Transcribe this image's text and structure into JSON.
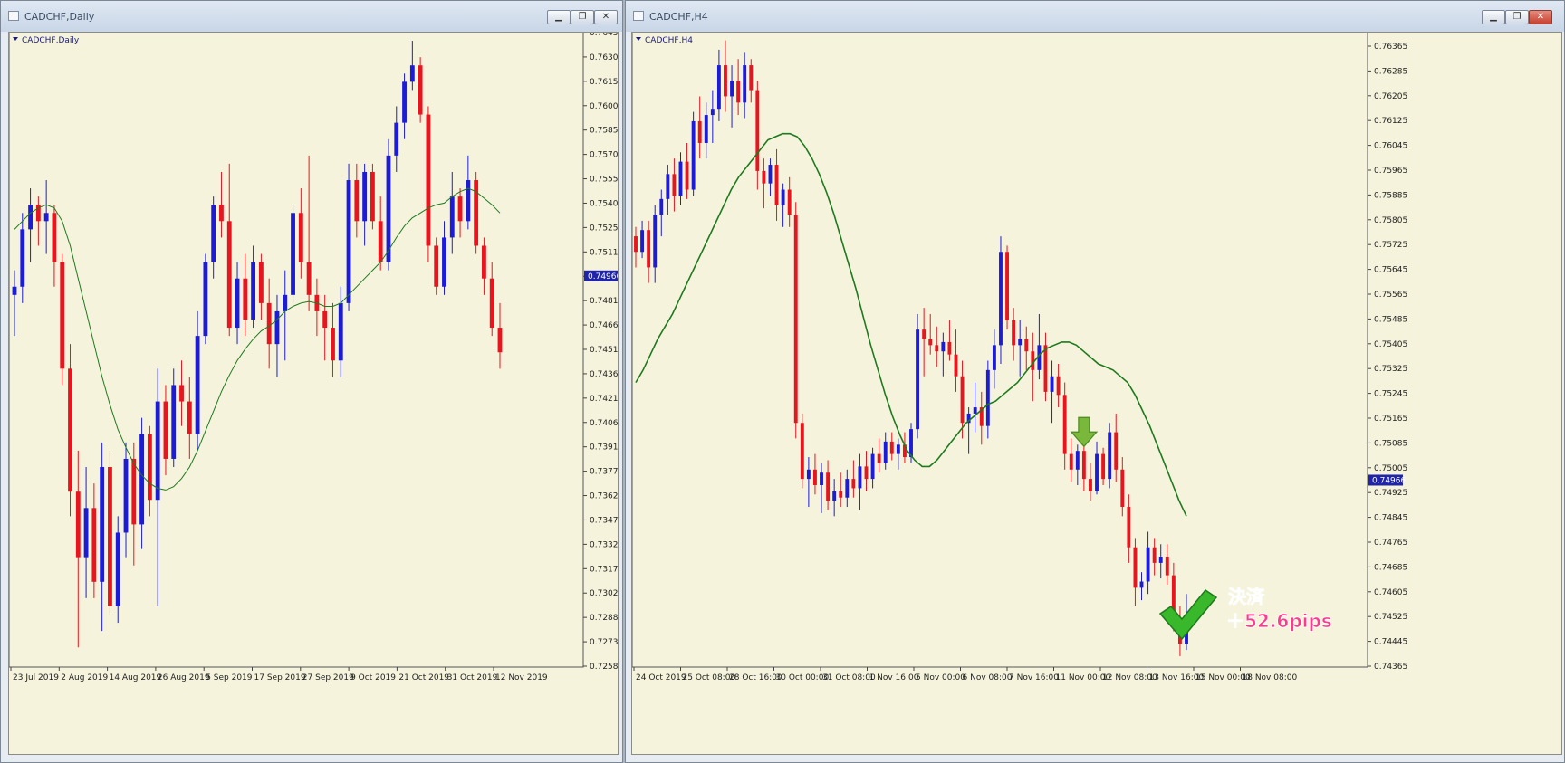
{
  "windows": [
    {
      "id": "daily",
      "title": "CADCHF,Daily",
      "chart_label": "CADCHF,Daily",
      "current_price": "0.74966",
      "price_ticks": [
        "0.76450",
        "0.76300",
        "0.76150",
        "0.76000",
        "0.75850",
        "0.75700",
        "0.75555",
        "0.75405",
        "0.75255",
        "0.75110",
        "0.74960",
        "0.74810",
        "0.74660",
        "0.74510",
        "0.74360",
        "0.74215",
        "0.74065",
        "0.73915",
        "0.73770",
        "0.73620",
        "0.73470",
        "0.73325",
        "0.73175",
        "0.73025",
        "0.72880",
        "0.72730",
        "0.72580"
      ],
      "time_ticks": [
        "23 Jul 2019",
        "2 Aug 2019",
        "14 Aug 2019",
        "26 Aug 2019",
        "5 Sep 2019",
        "17 Sep 2019",
        "27 Sep 2019",
        "9 Oct 2019",
        "21 Oct 2019",
        "31 Oct 2019",
        "12 Nov 2019"
      ]
    },
    {
      "id": "h4",
      "title": "CADCHF,H4",
      "chart_label": "CADCHF,H4",
      "current_price": "0.74966",
      "price_ticks": [
        "0.76365",
        "0.76285",
        "0.76205",
        "0.76125",
        "0.76045",
        "0.75965",
        "0.75885",
        "0.75805",
        "0.75725",
        "0.75645",
        "0.75565",
        "0.75485",
        "0.75405",
        "0.75325",
        "0.75245",
        "0.75165",
        "0.75085",
        "0.75005",
        "0.74925",
        "0.74845",
        "0.74765",
        "0.74685",
        "0.74605",
        "0.74525",
        "0.74445",
        "0.74365"
      ],
      "time_ticks": [
        "24 Oct 2019",
        "25 Oct 08:00",
        "28 Oct 16:00",
        "30 Oct 00:00",
        "31 Oct 08:00",
        "1 Nov 16:00",
        "5 Nov 00:00",
        "6 Nov 08:00",
        "7 Nov 16:00",
        "11 Nov 00:00",
        "12 Nov 08:00",
        "13 Nov 16:00",
        "15 Nov 00:00",
        "18 Nov 08:00"
      ],
      "annotation": {
        "line1": "決済",
        "line2": "＋52.6pips"
      }
    }
  ],
  "colors": {
    "bull": "#1c1cd8",
    "bear": "#e8141e",
    "ma": "#1e7a1e",
    "bg": "#f5f3dc",
    "arrow": "#7ab83c",
    "check": "#38b82a",
    "annotation": "#ff3a8c"
  },
  "icons": {
    "down_arrow": "down-arrow-icon",
    "check": "check-mark-icon"
  },
  "chart_data": [
    {
      "type": "candlestick",
      "title": "CADCHF,Daily",
      "ylim": [
        0.7258,
        0.7645
      ],
      "overlay": "moving-average",
      "candles": [
        [
          0.7485,
          0.75,
          0.746,
          0.749
        ],
        [
          0.749,
          0.7535,
          0.748,
          0.7525
        ],
        [
          0.7525,
          0.755,
          0.7505,
          0.754
        ],
        [
          0.754,
          0.7545,
          0.7515,
          0.753
        ],
        [
          0.753,
          0.7555,
          0.751,
          0.7535
        ],
        [
          0.7535,
          0.754,
          0.749,
          0.7505
        ],
        [
          0.7505,
          0.751,
          0.743,
          0.744
        ],
        [
          0.744,
          0.7455,
          0.735,
          0.7365
        ],
        [
          0.7365,
          0.739,
          0.727,
          0.7325
        ],
        [
          0.7325,
          0.738,
          0.73,
          0.7355
        ],
        [
          0.7355,
          0.737,
          0.73,
          0.731
        ],
        [
          0.731,
          0.7395,
          0.728,
          0.738
        ],
        [
          0.738,
          0.739,
          0.729,
          0.7295
        ],
        [
          0.7295,
          0.735,
          0.7285,
          0.734
        ],
        [
          0.734,
          0.7395,
          0.7325,
          0.7385
        ],
        [
          0.7385,
          0.7395,
          0.732,
          0.7345
        ],
        [
          0.7345,
          0.741,
          0.733,
          0.74
        ],
        [
          0.74,
          0.7405,
          0.735,
          0.736
        ],
        [
          0.736,
          0.744,
          0.7295,
          0.742
        ],
        [
          0.742,
          0.743,
          0.7375,
          0.7385
        ],
        [
          0.7385,
          0.744,
          0.738,
          0.743
        ],
        [
          0.743,
          0.7445,
          0.7405,
          0.742
        ],
        [
          0.742,
          0.7435,
          0.7385,
          0.74
        ],
        [
          0.74,
          0.7475,
          0.739,
          0.746
        ],
        [
          0.746,
          0.751,
          0.7455,
          0.7505
        ],
        [
          0.7505,
          0.7545,
          0.7495,
          0.754
        ],
        [
          0.754,
          0.756,
          0.752,
          0.753
        ],
        [
          0.753,
          0.7565,
          0.746,
          0.7465
        ],
        [
          0.7465,
          0.7505,
          0.7455,
          0.7495
        ],
        [
          0.7495,
          0.751,
          0.746,
          0.747
        ],
        [
          0.747,
          0.7515,
          0.7465,
          0.7505
        ],
        [
          0.7505,
          0.751,
          0.747,
          0.748
        ],
        [
          0.748,
          0.7495,
          0.744,
          0.7455
        ],
        [
          0.7455,
          0.7485,
          0.7435,
          0.7475
        ],
        [
          0.7475,
          0.75,
          0.7445,
          0.7485
        ],
        [
          0.7485,
          0.754,
          0.748,
          0.7535
        ],
        [
          0.7535,
          0.755,
          0.7495,
          0.7505
        ],
        [
          0.7505,
          0.757,
          0.7475,
          0.7485
        ],
        [
          0.7485,
          0.7495,
          0.746,
          0.7475
        ],
        [
          0.7475,
          0.7485,
          0.7445,
          0.7465
        ],
        [
          0.7465,
          0.748,
          0.7435,
          0.7445
        ],
        [
          0.7445,
          0.749,
          0.7435,
          0.748
        ],
        [
          0.748,
          0.7565,
          0.7475,
          0.7555
        ],
        [
          0.7555,
          0.7565,
          0.752,
          0.753
        ],
        [
          0.753,
          0.7565,
          0.7515,
          0.756
        ],
        [
          0.756,
          0.7565,
          0.7525,
          0.753
        ],
        [
          0.753,
          0.7545,
          0.75,
          0.7505
        ],
        [
          0.7505,
          0.758,
          0.75,
          0.757
        ],
        [
          0.757,
          0.76,
          0.756,
          0.759
        ],
        [
          0.759,
          0.762,
          0.758,
          0.7615
        ],
        [
          0.7615,
          0.764,
          0.761,
          0.7625
        ],
        [
          0.7625,
          0.763,
          0.759,
          0.7595
        ],
        [
          0.7595,
          0.76,
          0.7505,
          0.7515
        ],
        [
          0.7515,
          0.752,
          0.7485,
          0.749
        ],
        [
          0.749,
          0.753,
          0.7485,
          0.752
        ],
        [
          0.752,
          0.756,
          0.751,
          0.7545
        ],
        [
          0.7545,
          0.755,
          0.752,
          0.753
        ],
        [
          0.753,
          0.757,
          0.7525,
          0.7555
        ],
        [
          0.7555,
          0.756,
          0.751,
          0.7515
        ],
        [
          0.7515,
          0.752,
          0.7485,
          0.7495
        ],
        [
          0.7495,
          0.7505,
          0.746,
          0.7465
        ],
        [
          0.7465,
          0.748,
          0.744,
          0.745
        ]
      ],
      "ma": [
        0.7525,
        0.753,
        0.7535,
        0.7538,
        0.754,
        0.7538,
        0.753,
        0.7515,
        0.7495,
        0.7475,
        0.7455,
        0.7435,
        0.7418,
        0.7403,
        0.7392,
        0.7382,
        0.7375,
        0.737,
        0.7367,
        0.7366,
        0.7368,
        0.7373,
        0.738,
        0.739,
        0.7402,
        0.7414,
        0.7426,
        0.7436,
        0.7445,
        0.7452,
        0.7458,
        0.7463,
        0.7466,
        0.747,
        0.7475,
        0.7478,
        0.748,
        0.7481,
        0.748,
        0.7478,
        0.7478,
        0.748,
        0.7485,
        0.749,
        0.7495,
        0.75,
        0.7505,
        0.7512,
        0.752,
        0.7527,
        0.7532,
        0.7535,
        0.7538,
        0.754,
        0.7541,
        0.7545,
        0.7548,
        0.755,
        0.7548,
        0.7544,
        0.754,
        0.7535
      ]
    },
    {
      "type": "candlestick",
      "title": "CADCHF,H4",
      "ylim": [
        0.74365,
        0.76405
      ],
      "overlay": "moving-average",
      "candles": [
        [
          0.7575,
          0.7578,
          0.7565,
          0.757
        ],
        [
          0.757,
          0.758,
          0.7568,
          0.7577
        ],
        [
          0.7577,
          0.758,
          0.756,
          0.7565
        ],
        [
          0.7565,
          0.7585,
          0.756,
          0.7582
        ],
        [
          0.7582,
          0.759,
          0.7575,
          0.7587
        ],
        [
          0.7587,
          0.7598,
          0.7582,
          0.7595
        ],
        [
          0.7595,
          0.76,
          0.7583,
          0.7588
        ],
        [
          0.7588,
          0.7602,
          0.7585,
          0.7599
        ],
        [
          0.7599,
          0.7605,
          0.7587,
          0.759
        ],
        [
          0.759,
          0.7615,
          0.7588,
          0.7612
        ],
        [
          0.7612,
          0.762,
          0.76,
          0.7605
        ],
        [
          0.7605,
          0.7618,
          0.76,
          0.7614
        ],
        [
          0.7614,
          0.7622,
          0.7605,
          0.7616
        ],
        [
          0.7616,
          0.7635,
          0.7612,
          0.763
        ],
        [
          0.763,
          0.7638,
          0.7615,
          0.762
        ],
        [
          0.762,
          0.763,
          0.761,
          0.7625
        ],
        [
          0.7625,
          0.7632,
          0.7614,
          0.7618
        ],
        [
          0.7618,
          0.7634,
          0.7613,
          0.763
        ],
        [
          0.763,
          0.7632,
          0.7618,
          0.7622
        ],
        [
          0.7622,
          0.7625,
          0.759,
          0.7596
        ],
        [
          0.7596,
          0.76,
          0.7584,
          0.7592
        ],
        [
          0.7592,
          0.76,
          0.7588,
          0.7598
        ],
        [
          0.7598,
          0.7603,
          0.758,
          0.7585
        ],
        [
          0.7585,
          0.7592,
          0.7578,
          0.759
        ],
        [
          0.759,
          0.7594,
          0.7578,
          0.7582
        ],
        [
          0.7582,
          0.7586,
          0.751,
          0.7515
        ],
        [
          0.7515,
          0.7518,
          0.7494,
          0.7497
        ],
        [
          0.7497,
          0.7504,
          0.7488,
          0.75
        ],
        [
          0.75,
          0.7505,
          0.7492,
          0.7495
        ],
        [
          0.7495,
          0.7502,
          0.7486,
          0.7499
        ],
        [
          0.7499,
          0.7503,
          0.7487,
          0.749
        ],
        [
          0.749,
          0.7497,
          0.7485,
          0.7493
        ],
        [
          0.7493,
          0.7499,
          0.7488,
          0.7491
        ],
        [
          0.7491,
          0.75,
          0.7488,
          0.7497
        ],
        [
          0.7497,
          0.7503,
          0.7491,
          0.7494
        ],
        [
          0.7494,
          0.7505,
          0.7487,
          0.7501
        ],
        [
          0.7501,
          0.7506,
          0.7493,
          0.7497
        ],
        [
          0.7497,
          0.7507,
          0.7494,
          0.7505
        ],
        [
          0.7505,
          0.751,
          0.7499,
          0.7502
        ],
        [
          0.7502,
          0.7512,
          0.75,
          0.7509
        ],
        [
          0.7509,
          0.7512,
          0.7503,
          0.7505
        ],
        [
          0.7505,
          0.751,
          0.75,
          0.7508
        ],
        [
          0.7508,
          0.7512,
          0.7502,
          0.7504
        ],
        [
          0.7504,
          0.7515,
          0.7502,
          0.7513
        ],
        [
          0.7513,
          0.755,
          0.751,
          0.7545
        ],
        [
          0.7545,
          0.7552,
          0.753,
          0.7542
        ],
        [
          0.7542,
          0.755,
          0.7537,
          0.754
        ],
        [
          0.754,
          0.7546,
          0.7533,
          0.7538
        ],
        [
          0.7538,
          0.7544,
          0.753,
          0.7541
        ],
        [
          0.7541,
          0.7548,
          0.7535,
          0.7537
        ],
        [
          0.7537,
          0.7545,
          0.7525,
          0.753
        ],
        [
          0.753,
          0.7535,
          0.751,
          0.7515
        ],
        [
          0.7515,
          0.752,
          0.7505,
          0.7518
        ],
        [
          0.7518,
          0.7528,
          0.7512,
          0.752
        ],
        [
          0.752,
          0.7525,
          0.7508,
          0.7514
        ],
        [
          0.7514,
          0.7535,
          0.751,
          0.7532
        ],
        [
          0.7532,
          0.7545,
          0.7526,
          0.754
        ],
        [
          0.754,
          0.7575,
          0.7534,
          0.757
        ],
        [
          0.757,
          0.7572,
          0.7545,
          0.7548
        ],
        [
          0.7548,
          0.7552,
          0.7535,
          0.754
        ],
        [
          0.754,
          0.7548,
          0.753,
          0.7542
        ],
        [
          0.7542,
          0.7546,
          0.7532,
          0.7538
        ],
        [
          0.7538,
          0.7544,
          0.7522,
          0.7532
        ],
        [
          0.7532,
          0.755,
          0.7529,
          0.754
        ],
        [
          0.754,
          0.7544,
          0.7522,
          0.7525
        ],
        [
          0.7525,
          0.7535,
          0.7515,
          0.753
        ],
        [
          0.753,
          0.7534,
          0.752,
          0.7524
        ],
        [
          0.7524,
          0.7528,
          0.75,
          0.7505
        ],
        [
          0.7505,
          0.751,
          0.7496,
          0.75
        ],
        [
          0.75,
          0.7508,
          0.7495,
          0.7506
        ],
        [
          0.7506,
          0.751,
          0.7493,
          0.7497
        ],
        [
          0.7497,
          0.7502,
          0.749,
          0.7493
        ],
        [
          0.7493,
          0.7509,
          0.7492,
          0.7505
        ],
        [
          0.7505,
          0.7507,
          0.7495,
          0.7497
        ],
        [
          0.7497,
          0.7515,
          0.7494,
          0.7512
        ],
        [
          0.7512,
          0.7518,
          0.7496,
          0.75
        ],
        [
          0.75,
          0.7504,
          0.7485,
          0.7488
        ],
        [
          0.7488,
          0.7492,
          0.747,
          0.7475
        ],
        [
          0.7475,
          0.7478,
          0.7456,
          0.7462
        ],
        [
          0.7462,
          0.7467,
          0.7458,
          0.7464
        ],
        [
          0.7464,
          0.748,
          0.746,
          0.7475
        ],
        [
          0.7475,
          0.7478,
          0.7466,
          0.747
        ],
        [
          0.747,
          0.7476,
          0.7465,
          0.7472
        ],
        [
          0.7472,
          0.7476,
          0.7463,
          0.7466
        ],
        [
          0.7466,
          0.747,
          0.7448,
          0.7452
        ],
        [
          0.7452,
          0.7456,
          0.744,
          0.7444
        ],
        [
          0.7444,
          0.746,
          0.7442,
          0.7448
        ]
      ],
      "ma": [
        0.7528,
        0.7532,
        0.7537,
        0.7542,
        0.7546,
        0.755,
        0.7555,
        0.756,
        0.7565,
        0.757,
        0.7575,
        0.758,
        0.7585,
        0.759,
        0.7594,
        0.7597,
        0.76,
        0.7603,
        0.7606,
        0.7607,
        0.7608,
        0.7608,
        0.7607,
        0.7604,
        0.76,
        0.7595,
        0.7589,
        0.7582,
        0.7574,
        0.7566,
        0.7558,
        0.7549,
        0.754,
        0.7532,
        0.7524,
        0.7517,
        0.7511,
        0.7506,
        0.7503,
        0.7501,
        0.7501,
        0.7503,
        0.7506,
        0.7509,
        0.7512,
        0.7515,
        0.7517,
        0.7519,
        0.7521,
        0.7522,
        0.7524,
        0.7526,
        0.7528,
        0.7531,
        0.7534,
        0.7537,
        0.7539,
        0.754,
        0.7541,
        0.7541,
        0.754,
        0.7538,
        0.7536,
        0.7534,
        0.7533,
        0.7532,
        0.753,
        0.7528,
        0.7524,
        0.7519,
        0.7514,
        0.7508,
        0.7502,
        0.7496,
        0.749,
        0.7485
      ]
    }
  ]
}
